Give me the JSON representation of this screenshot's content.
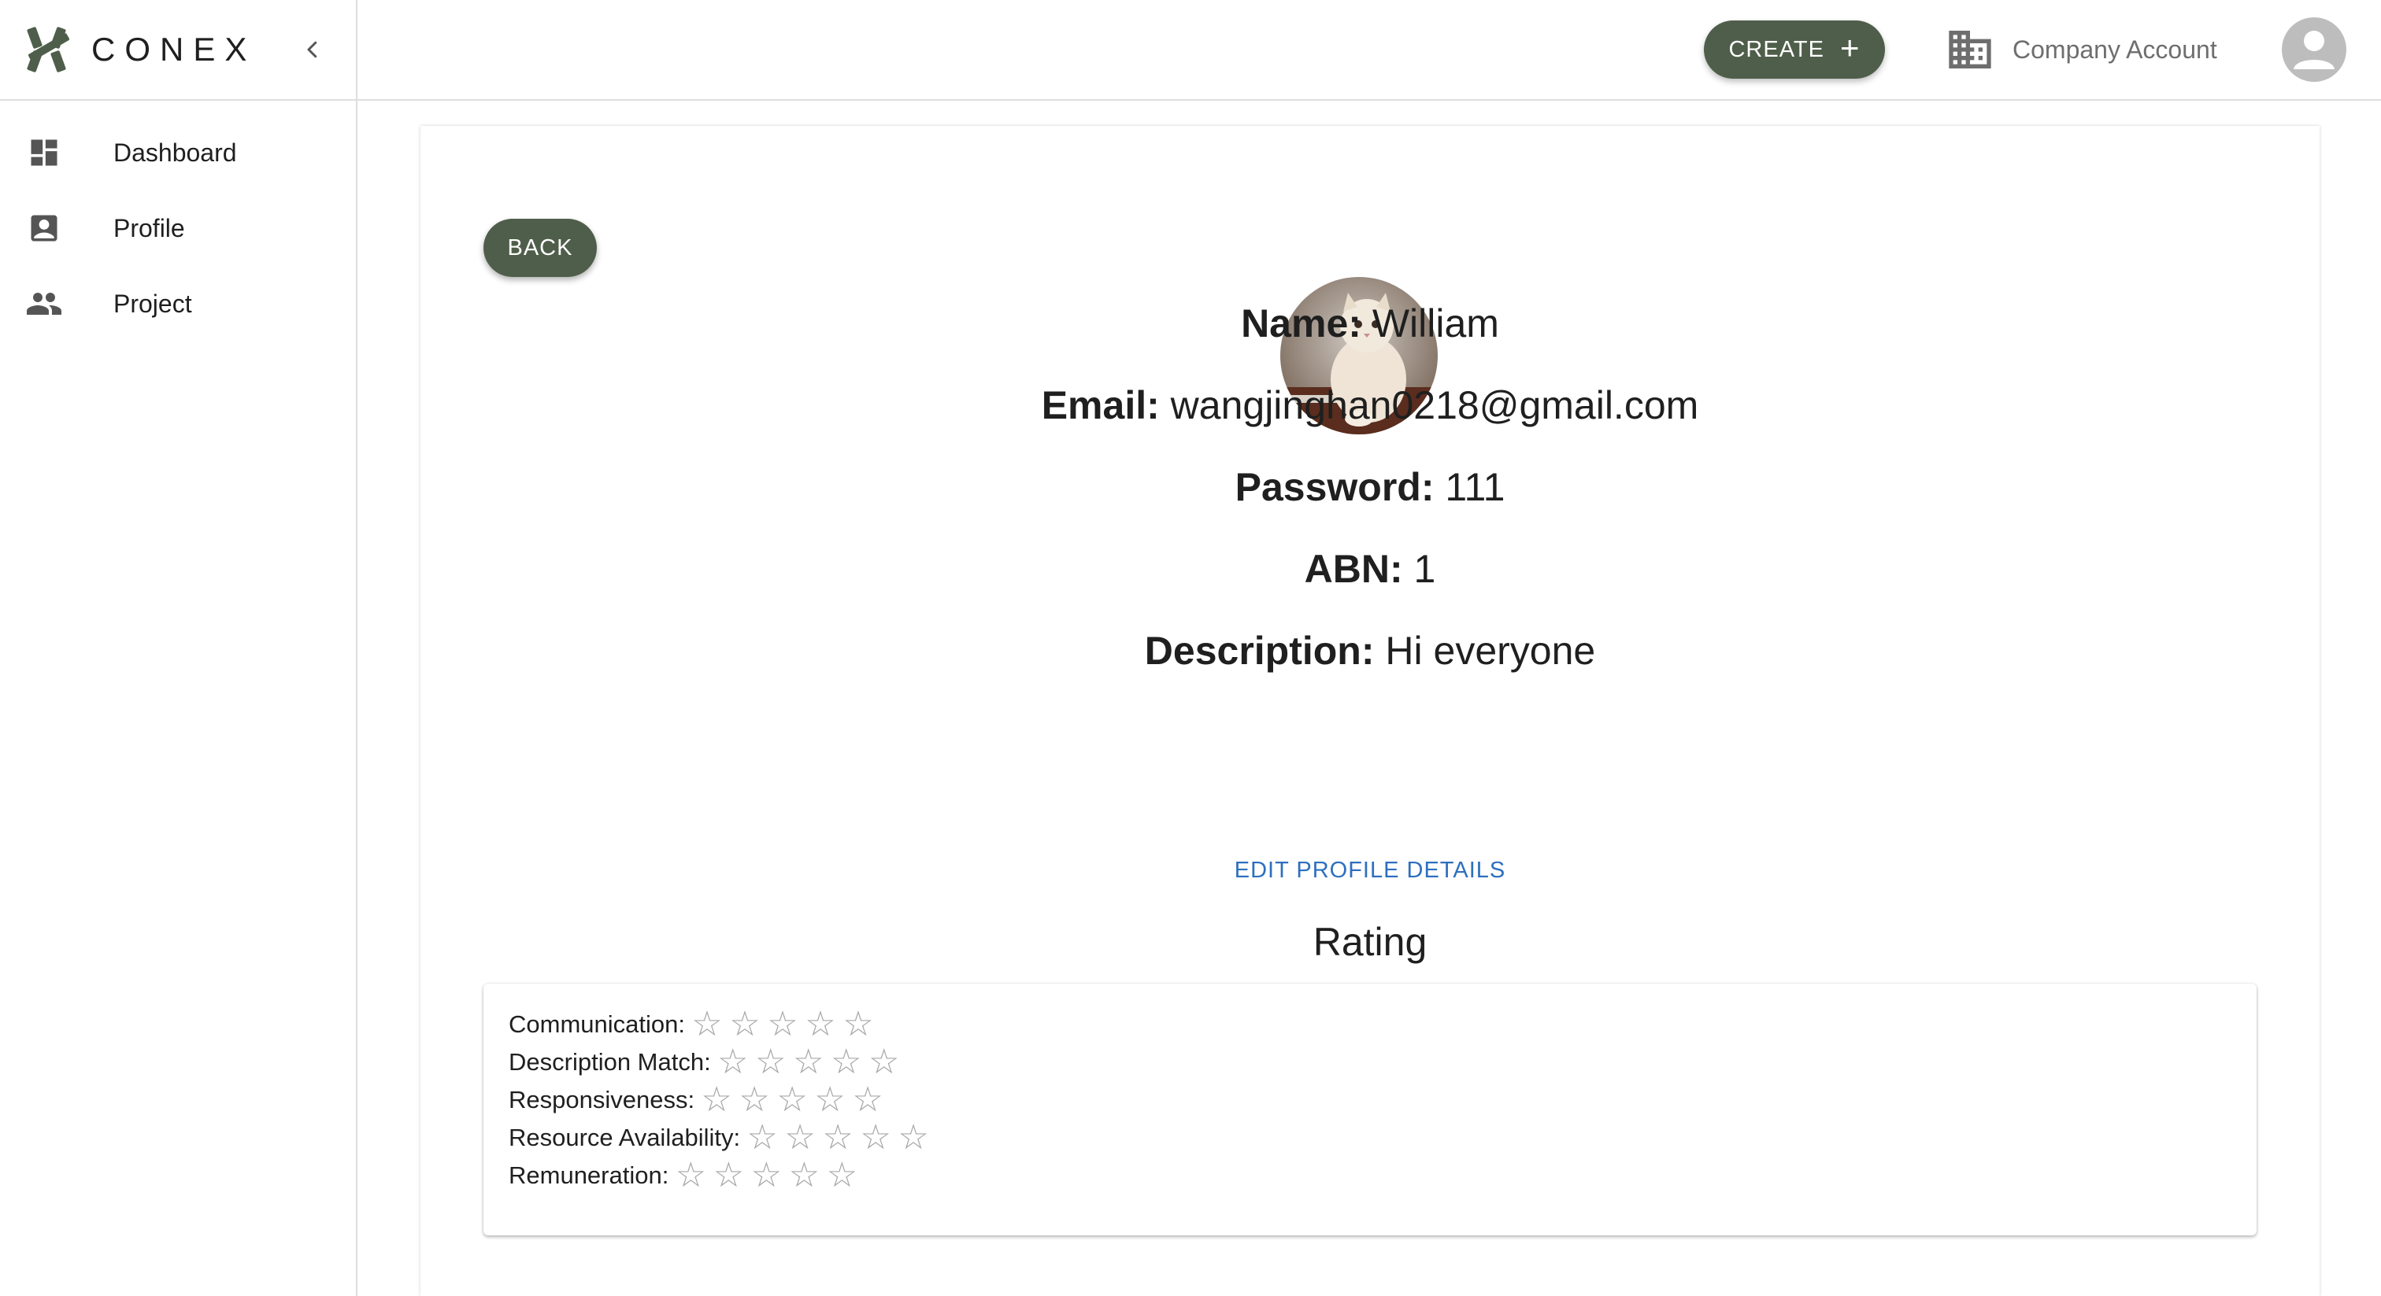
{
  "brand": {
    "name": "CONEX"
  },
  "topbar": {
    "create_label": "CREATE",
    "create_icon": "plus-icon",
    "account_label": "Company Account"
  },
  "sidebar": {
    "items": [
      {
        "label": "Dashboard",
        "icon": "dashboard-icon"
      },
      {
        "label": "Profile",
        "icon": "profile-icon"
      },
      {
        "label": "Project",
        "icon": "people-icon"
      }
    ]
  },
  "profile": {
    "back_label": "BACK",
    "fields": [
      {
        "label": "Name:",
        "value": "William"
      },
      {
        "label": "Email:",
        "value": "wangjinghan0218@gmail.com"
      },
      {
        "label": "Password:",
        "value": "111"
      },
      {
        "label": "ABN:",
        "value": "1"
      },
      {
        "label": "Description:",
        "value": "Hi everyone"
      }
    ],
    "edit_label": "EDIT PROFILE DETAILS"
  },
  "rating": {
    "title": "Rating",
    "max_stars": 5,
    "categories": [
      {
        "label": "Communication:",
        "stars": 0
      },
      {
        "label": "Description Match:",
        "stars": 0
      },
      {
        "label": "Responsiveness:",
        "stars": 0
      },
      {
        "label": "Resource Availability:",
        "stars": 0
      },
      {
        "label": "Remuneration:",
        "stars": 0
      }
    ]
  },
  "colors": {
    "accent": "#4f5e4a",
    "link": "#2e6fbf",
    "star_empty": "#a8a8a8"
  }
}
